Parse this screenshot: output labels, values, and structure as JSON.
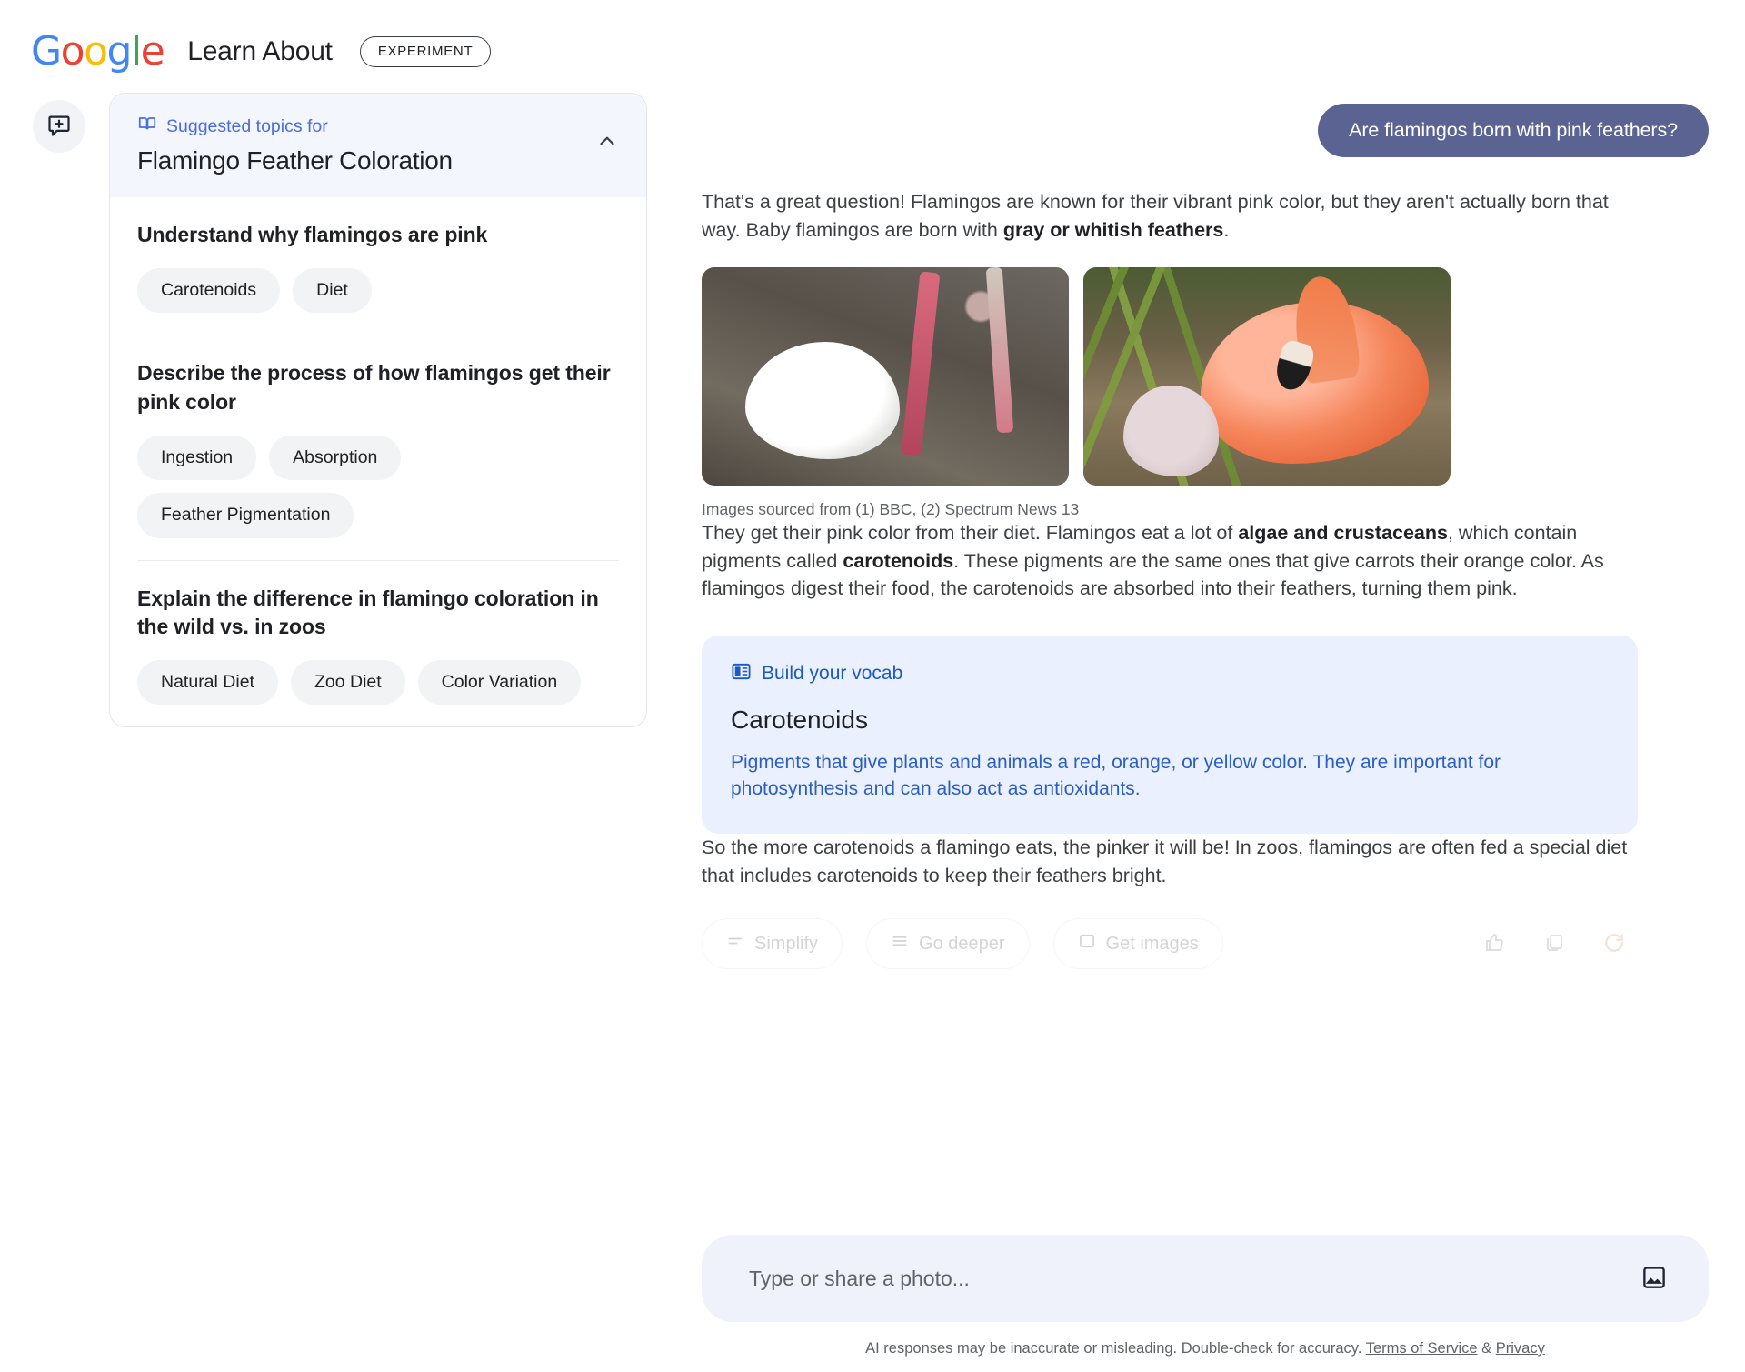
{
  "header": {
    "logo_letters": [
      {
        "ch": "G",
        "color": "#4285F4"
      },
      {
        "ch": "o",
        "color": "#EA4335"
      },
      {
        "ch": "o",
        "color": "#FBBC05"
      },
      {
        "ch": "g",
        "color": "#4285F4"
      },
      {
        "ch": "l",
        "color": "#34A853"
      },
      {
        "ch": "e",
        "color": "#EA4335"
      }
    ],
    "app_title": "Learn About",
    "experiment_badge": "EXPERIMENT"
  },
  "sidebar": {
    "new_chat_icon": "new-chat-bubble-icon",
    "panel": {
      "eyebrow_icon": "open-book-icon",
      "eyebrow": "Suggested topics for",
      "title": "Flamingo Feather Coloration",
      "collapse_icon": "chevron-up-icon",
      "groups": [
        {
          "question": "Understand why flamingos are pink",
          "chips": [
            "Carotenoids",
            "Diet"
          ]
        },
        {
          "question": "Describe the process of how flamingos get their pink color",
          "chips": [
            "Ingestion",
            "Absorption",
            "Feather Pigmentation"
          ]
        },
        {
          "question": "Explain the difference in flamingo coloration in the wild vs. in zoos",
          "chips": [
            "Natural Diet",
            "Zoo Diet",
            "Color Variation"
          ]
        }
      ]
    }
  },
  "conversation": {
    "user_question": "Are flamingos born with pink feathers?",
    "paragraph_1_a": "That's a great question! Flamingos are known for their vibrant pink color, but they aren't actually born that way. Baby flamingos are born with ",
    "paragraph_1_bold": "gray or whitish feathers",
    "paragraph_1_b": ".",
    "images": [
      {
        "alt": "White flamingo chick sitting on the ground beside adult flamingo legs"
      },
      {
        "alt": "Adult pink flamingo preening next to a pale grey chick"
      }
    ],
    "caption_prefix": "Images sourced from (1) ",
    "caption_link_1": "BBC",
    "caption_middle": ", (2) ",
    "caption_link_2": "Spectrum News 13",
    "paragraph_2_a": "They get their pink color from their diet. Flamingos eat a lot of ",
    "paragraph_2_bold_1": "algae and crustaceans",
    "paragraph_2_b": ", which contain pigments called ",
    "paragraph_2_bold_2": "carotenoids",
    "paragraph_2_c": ". These pigments are the same ones that give carrots their orange color. As flamingos digest their food, the carotenoids are absorbed into their feathers, turning them pink.",
    "vocab": {
      "icon": "vocab-book-icon",
      "eyebrow": "Build your vocab",
      "term": "Carotenoids",
      "definition": "Pigments that give plants and animals a red, orange, or yellow color. They are important for photosynthesis and can also act as antioxidants."
    },
    "paragraph_3": "So the more carotenoids a flamingo eats, the pinker it will be! In zoos, flamingos are often fed a special diet that includes carotenoids to keep their feathers bright.",
    "actions": [
      {
        "label": "Simplify",
        "icon": "simplify-icon"
      },
      {
        "label": "Go deeper",
        "icon": "go-deeper-icon"
      },
      {
        "label": "Get images",
        "icon": "get-images-icon"
      }
    ],
    "action_icons": [
      {
        "name": "thumb-up-icon"
      },
      {
        "name": "copy-icon"
      },
      {
        "name": "refresh-icon"
      }
    ]
  },
  "composer": {
    "placeholder": "Type or share a photo...",
    "image_button_icon": "image-upload-icon"
  },
  "footer": {
    "disclaimer_text": "AI responses may be inaccurate or misleading. Double-check for accuracy. ",
    "terms_link": "Terms of Service",
    "amp": " & ",
    "privacy_link": "Privacy"
  },
  "colors": {
    "accent_blue": "#4c6ddb",
    "user_bubble": "#5a6391",
    "vocab_bg": "#eaf0fd",
    "vocab_text": "#2b5fc4",
    "chip_bg": "#f1f3f4"
  }
}
